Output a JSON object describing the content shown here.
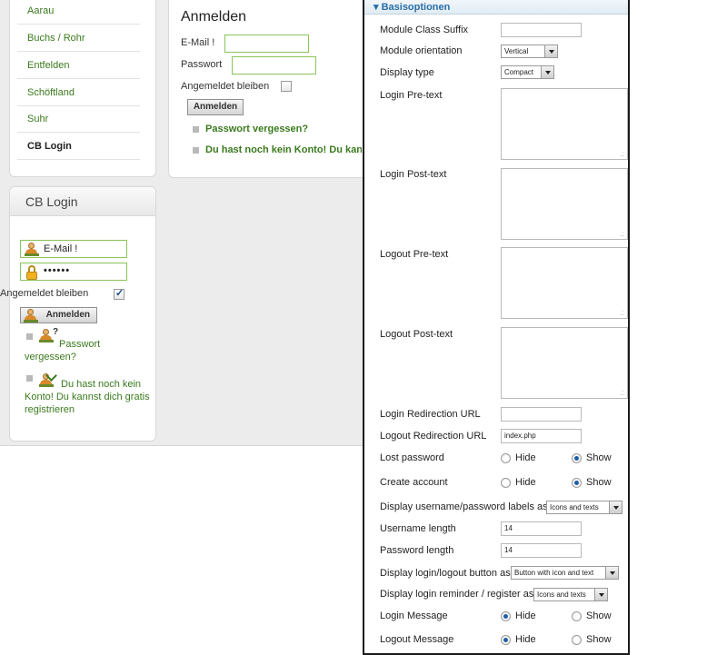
{
  "nav": {
    "items": [
      {
        "label": "Aarau"
      },
      {
        "label": "Buchs / Rohr"
      },
      {
        "label": "Entfelden"
      },
      {
        "label": "Schöftland"
      },
      {
        "label": "Suhr"
      },
      {
        "label": "CB Login"
      }
    ]
  },
  "login_form": {
    "title": "Anmelden",
    "email_label": "E-Mail !",
    "password_label": "Passwort",
    "remember_label": "Angemeldet bleiben",
    "submit_label": "Anmelden",
    "forgot_link": "Passwort vergessen?",
    "register_link": "Du hast noch kein Konto! Du kannst"
  },
  "module": {
    "title": "CB Login",
    "email_value": "E-Mail !",
    "password_value": "••••••",
    "remember_label": "Angemeldet bleiben",
    "remember_checked": true,
    "submit_label": "Anmelden",
    "forgot_link": "Passwort vergessen?",
    "register_link": "Du hast noch kein Konto! Du kannst dich gratis registrieren"
  },
  "panel": {
    "title": "Basisoptionen",
    "fields": {
      "module_class_suffix": {
        "label": "Module Class Suffix",
        "value": ""
      },
      "module_orientation": {
        "label": "Module orientation",
        "value": "Vertical"
      },
      "display_type": {
        "label": "Display type",
        "value": "Compact"
      },
      "login_pretext": {
        "label": "Login Pre-text"
      },
      "login_posttext": {
        "label": "Login Post-text"
      },
      "logout_pretext": {
        "label": "Logout Pre-text"
      },
      "logout_posttext": {
        "label": "Logout Post-text"
      },
      "login_redirect": {
        "label": "Login Redirection URL",
        "value": ""
      },
      "logout_redirect": {
        "label": "Logout Redirection URL",
        "value": "index.php"
      },
      "lost_password": {
        "label": "Lost password",
        "options": [
          "Hide",
          "Show"
        ],
        "selected": "Show"
      },
      "create_account": {
        "label": "Create account",
        "options": [
          "Hide",
          "Show"
        ],
        "selected": "Show"
      },
      "display_labels": {
        "label": "Display username/password labels as",
        "value": "Icons and texts"
      },
      "username_length": {
        "label": "Username length",
        "value": "14"
      },
      "password_length": {
        "label": "Password length",
        "value": "14"
      },
      "display_button": {
        "label": "Display login/logout button as",
        "value": "Button with icon and text"
      },
      "display_reminder": {
        "label": "Display login reminder / register as",
        "value": "Icons and texts"
      },
      "login_message": {
        "label": "Login Message",
        "options": [
          "Hide",
          "Show"
        ],
        "selected": "Hide"
      },
      "logout_message": {
        "label": "Logout Message",
        "options": [
          "Hide",
          "Show"
        ],
        "selected": "Hide"
      }
    }
  }
}
